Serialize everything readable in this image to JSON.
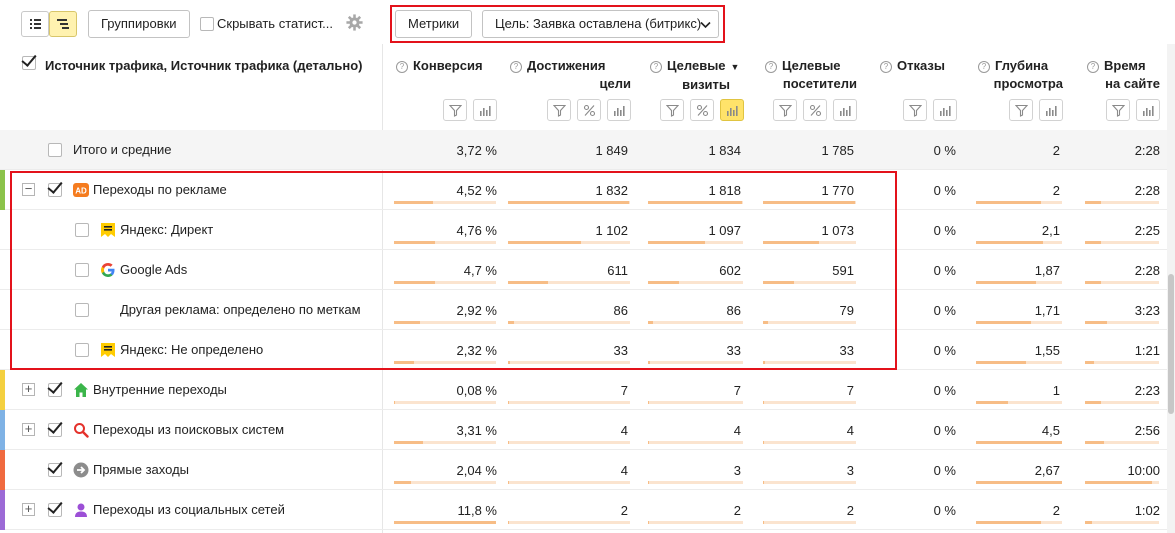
{
  "toolbar": {
    "groupings_label": "Группировки",
    "hide_stats_label": "Скрывать статист...",
    "metrics_label": "Метрики",
    "goal_label": "Цель: Заявка оставлена (битрикс)"
  },
  "dimension_header": "Источник трафика, Источник трафика (детально)",
  "columns": [
    {
      "line1": "Конверсия",
      "line2": ""
    },
    {
      "line1": "Достижения",
      "line2": "цели"
    },
    {
      "line1": "Целевые",
      "line2": "визиты"
    },
    {
      "line1": "Целевые",
      "line2": "посетители"
    },
    {
      "line1": "Отказы",
      "line2": ""
    },
    {
      "line1": "Глубина",
      "line2": "просмотра"
    },
    {
      "line1": "Время",
      "line2": "на сайте"
    }
  ],
  "sort_marker": "▼",
  "rows": [
    {
      "label": "Итого и средние",
      "values": [
        "3,72 %",
        "1 849",
        "1 834",
        "1 785",
        "0 %",
        "2",
        "2:28"
      ]
    },
    {
      "label": "Переходы по рекламе",
      "values": [
        "4,52 %",
        "1 832",
        "1 818",
        "1 770",
        "0 %",
        "2",
        "2:28"
      ],
      "bars": [
        0.38,
        0.99,
        0.99,
        0.99,
        0,
        0.75,
        0.22
      ]
    },
    {
      "label": "Яндекс: Директ",
      "values": [
        "4,76 %",
        "1 102",
        "1 097",
        "1 073",
        "0 %",
        "2,1",
        "2:25"
      ],
      "bars": [
        0.4,
        0.6,
        0.6,
        0.6,
        0,
        0.78,
        0.21
      ]
    },
    {
      "label": "Google Ads",
      "values": [
        "4,7 %",
        "611",
        "602",
        "591",
        "0 %",
        "1,87",
        "2:28"
      ],
      "bars": [
        0.4,
        0.33,
        0.33,
        0.33,
        0,
        0.7,
        0.22
      ]
    },
    {
      "label": "Другая реклама: определено по меткам",
      "values": [
        "2,92 %",
        "86",
        "86",
        "79",
        "0 %",
        "1,71",
        "3:23"
      ],
      "bars": [
        0.25,
        0.05,
        0.05,
        0.05,
        0,
        0.64,
        0.3
      ]
    },
    {
      "label": "Яндекс: Не определено",
      "values": [
        "2,32 %",
        "33",
        "33",
        "33",
        "0 %",
        "1,55",
        "1:21"
      ],
      "bars": [
        0.2,
        0.02,
        0.02,
        0.02,
        0,
        0.58,
        0.12
      ]
    },
    {
      "label": "Внутренние переходы",
      "values": [
        "0,08 %",
        "7",
        "7",
        "7",
        "0 %",
        "1",
        "2:23"
      ],
      "bars": [
        0.01,
        0.01,
        0.01,
        0.01,
        0,
        0.37,
        0.21
      ]
    },
    {
      "label": "Переходы из поисковых систем",
      "values": [
        "3,31 %",
        "4",
        "4",
        "4",
        "0 %",
        "4,5",
        "2:56"
      ],
      "bars": [
        0.28,
        0.01,
        0.01,
        0.01,
        0,
        1.0,
        0.26
      ]
    },
    {
      "label": "Прямые заходы",
      "values": [
        "2,04 %",
        "4",
        "3",
        "3",
        "0 %",
        "2,67",
        "10:00"
      ],
      "bars": [
        0.17,
        0.01,
        0.01,
        0.01,
        0,
        1.0,
        0.9
      ]
    },
    {
      "label": "Переходы из социальных сетей",
      "values": [
        "11,8 %",
        "2",
        "2",
        "2",
        "0 %",
        "2",
        "1:02"
      ],
      "bars": [
        1.0,
        0.01,
        0.01,
        0.01,
        0,
        0.75,
        0.09
      ]
    }
  ],
  "colors": {
    "accent_yellow": "#ffe36a",
    "highlight_red": "#e3121b",
    "bar_fill": "#f7bd86",
    "bar_track": "#fbe4cf",
    "stripe_ads": "#8bc34a",
    "stripe_internal": "#f4d03f",
    "stripe_search": "#7fb2e5",
    "stripe_direct": "#f06a3f",
    "stripe_social": "#9c6ad6"
  },
  "icons": {
    "ads": "ad-icon",
    "yandex": "yandex-direct-icon",
    "google": "google-icon",
    "internal": "home-icon",
    "search": "search-icon",
    "direct": "arrow-right-icon",
    "social": "person-icon"
  }
}
